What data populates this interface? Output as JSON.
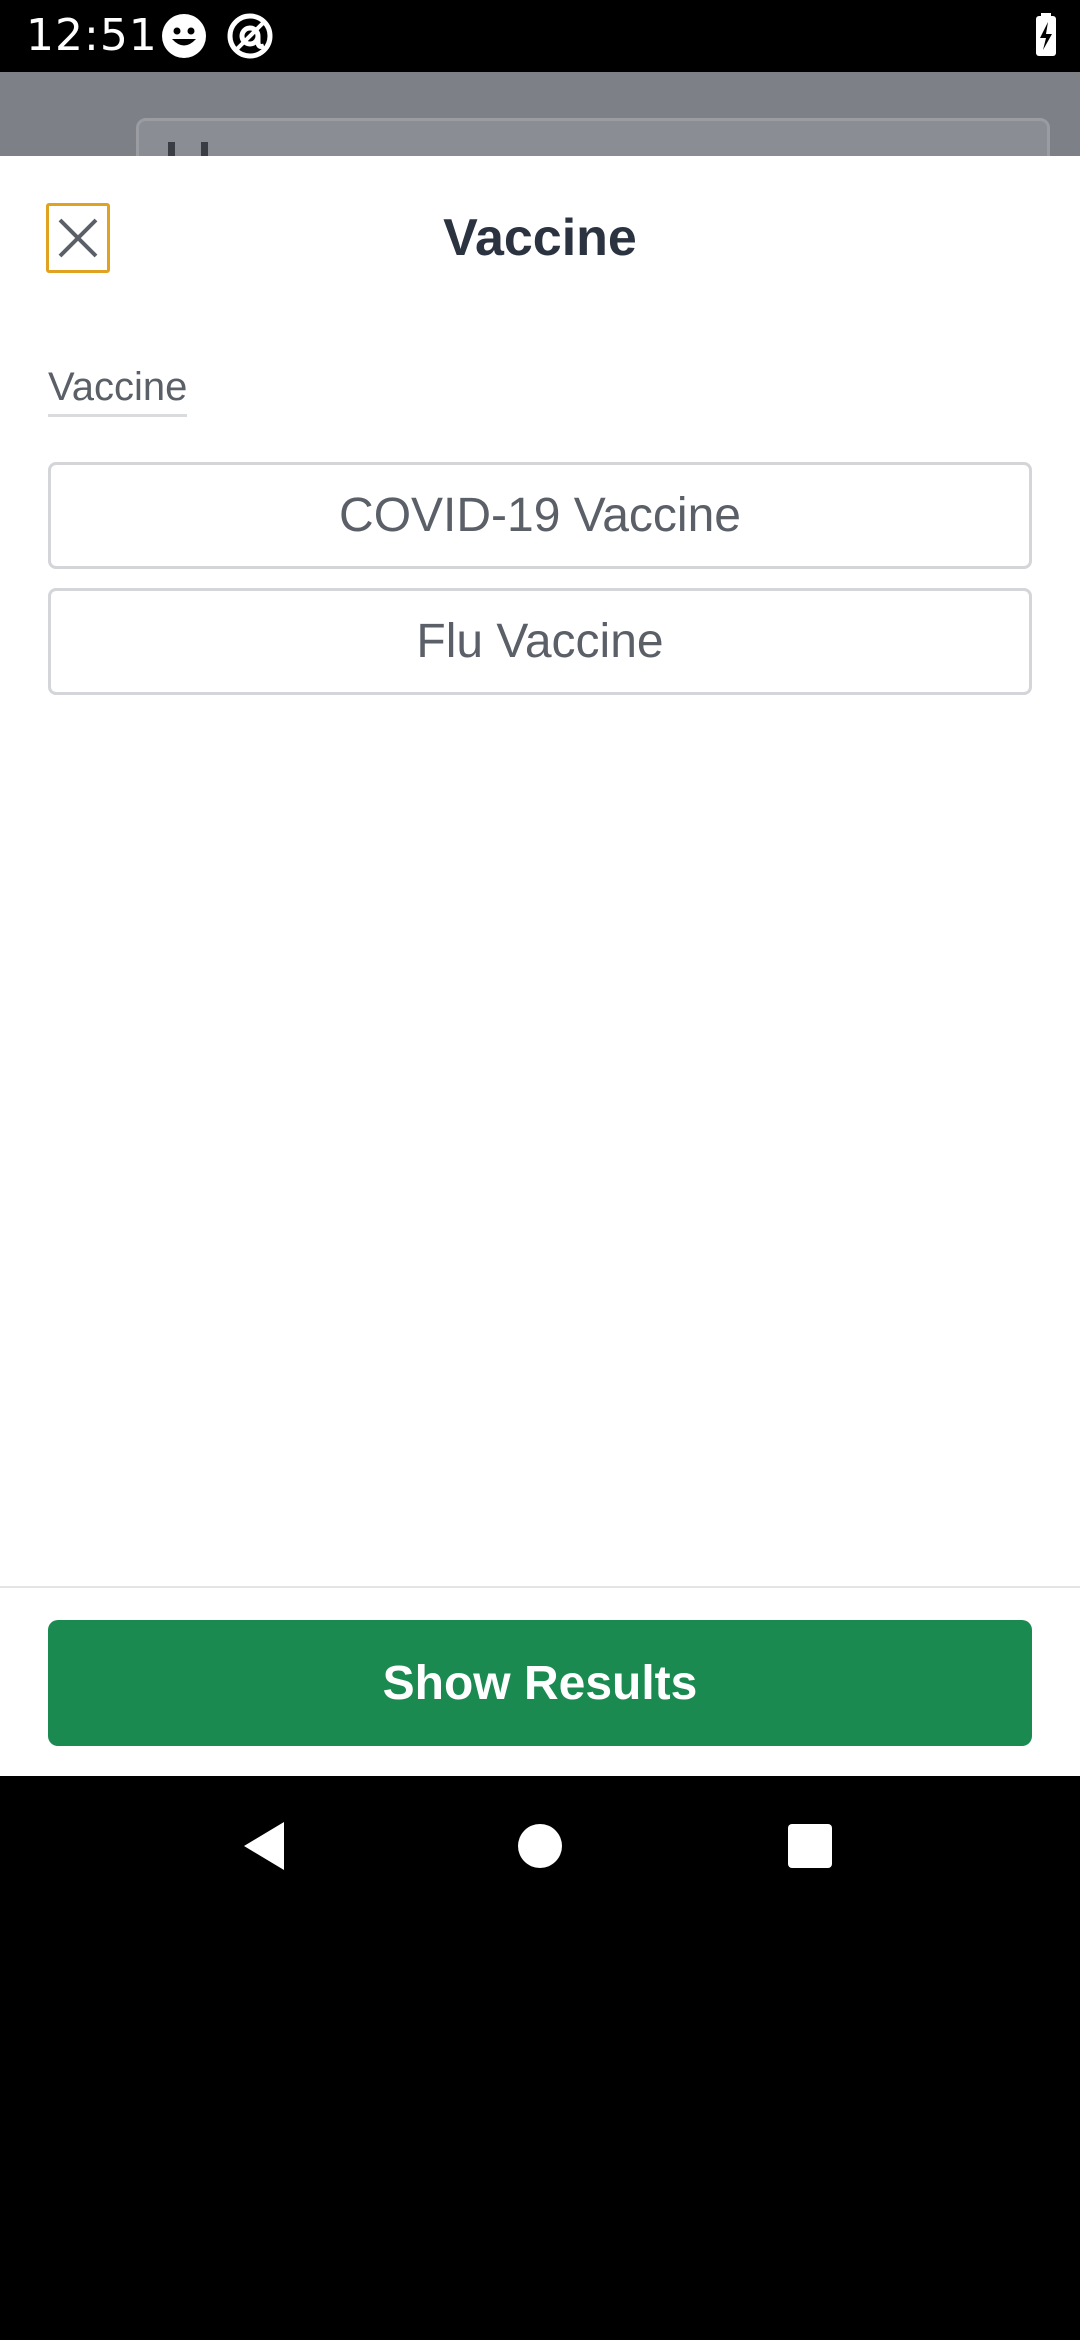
{
  "status_bar": {
    "time": "12:51",
    "icons": [
      "smiley-icon",
      "at-sign-icon",
      "battery-charging-icon"
    ]
  },
  "sheet": {
    "title": "Vaccine",
    "close_icon": "close-icon",
    "section_label": "Vaccine",
    "options": [
      {
        "label": "COVID-19 Vaccine"
      },
      {
        "label": "Flu Vaccine"
      }
    ],
    "show_results_label": "Show Results"
  },
  "colors": {
    "primary_button": "#1a8a50",
    "focus_ring": "#e0a321",
    "title_text": "#2b3340",
    "option_text": "#5a5f68"
  },
  "nav_bar": {
    "buttons": [
      "back-icon",
      "home-icon",
      "recents-icon"
    ]
  }
}
